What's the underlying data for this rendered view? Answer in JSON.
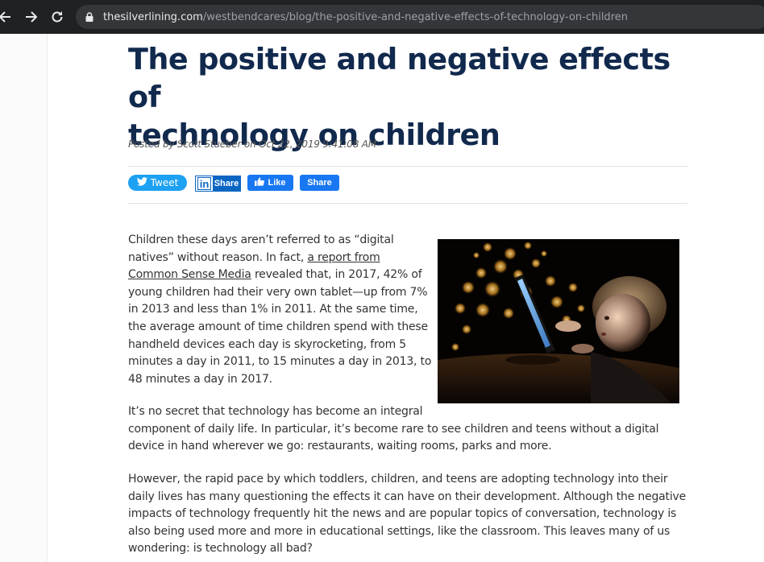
{
  "browser": {
    "url_domain": "thesilverlining.com",
    "url_path": "/westbendcares/blog/the-positive-and-negative-effects-of-technology-on-children"
  },
  "article": {
    "title_line1": "The positive and negative effects of",
    "title_line2": "technology on children",
    "byline": "Posted by Scott Stueber on Oct 22, 2019 9:41:08 AM"
  },
  "share": {
    "tweet_label": "Tweet",
    "linkedin_logo": "in",
    "linkedin_label": "Share",
    "like_label": "Like",
    "fb_share_label": "Share"
  },
  "body": {
    "p1_lines": [
      "Children these days aren’t referred to as “digital",
      "natives” without reason. In fact, ",
      "Common Sense Media",
      " revealed that, in 2017, 42% of",
      "young children had their very own tablet—up from 7%",
      "in 2013 and less than 1% in 2011. At the same time,",
      "the average amount of time children spend with these",
      "handheld devices each day is skyrocketing, from 5",
      "minutes a day in 2011, to 15 minutes a day in 2013, to",
      "48 minutes a day in 2017."
    ],
    "p1_link1": "a report from",
    "p2_lines": [
      "It’s no secret that technology has become an integral",
      "component of daily life. In particular, it’s become rare to see children and teens without a digital",
      "device in hand wherever we go: restaurants, waiting rooms, parks and more."
    ],
    "p3_lines": [
      "However, the rapid pace by which toddlers, children, and teens are adopting technology into their",
      "daily lives has many questioning the effects it can have on their development. Although the negative",
      "impacts of technology frequently hit the news and are popular topics of conversation, technology is",
      "also being used more and more in educational settings, like the classroom. This leaves many of us",
      "wondering: is technology all bad?"
    ]
  },
  "colors": {
    "title": "#11294d",
    "twitter": "#1da1f2",
    "linkedin": "#0a66c2",
    "facebook": "#1877f2"
  },
  "icons": [
    "back-arrow-icon",
    "forward-arrow-icon",
    "reload-icon",
    "lock-icon",
    "twitter-bird-icon",
    "linkedin-icon",
    "thumbs-up-icon"
  ]
}
